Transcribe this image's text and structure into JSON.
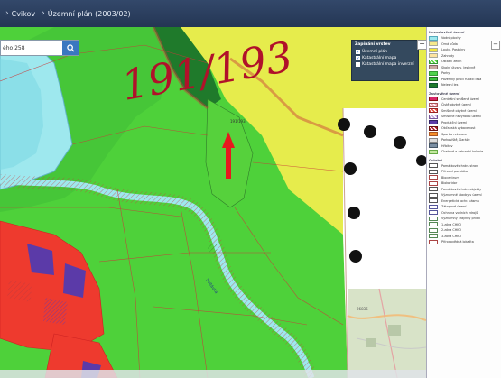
{
  "header": {
    "breadcrumb": [
      {
        "label": "Cvikov"
      },
      {
        "label": "Územní plán (2003/02)"
      }
    ]
  },
  "search": {
    "value": "ého 258"
  },
  "annotation": {
    "text": "191/193",
    "color": "#b0112a"
  },
  "layers_panel": {
    "title": "Zapínání vrstev",
    "items": [
      {
        "label": "Územní plán",
        "checked": true
      },
      {
        "label": "Katastrální mapa",
        "checked": true
      },
      {
        "label": "Katastrální mapa inverzní",
        "checked": false
      }
    ]
  },
  "map_labels": {
    "parcel_1": "191/193",
    "stream": "Svitávka"
  },
  "minimap": {
    "label": "26836"
  },
  "legend": {
    "sections": [
      {
        "title": "Nezastavěné území",
        "items": [
          {
            "label": "Vodní plochy",
            "color": "#9ee8ee",
            "stroke": "#5ab"
          },
          {
            "label": "Orná půda",
            "color": "#f5e98a",
            "stroke": "#aa9"
          },
          {
            "label": "Louky, Pastviny",
            "color": "#f2e63a",
            "stroke": "#aa9"
          },
          {
            "label": "Zahrady",
            "color": "#fde3a0",
            "stroke": "#aa9"
          },
          {
            "label": "Ostatní zeleň",
            "color": "#56d13c",
            "stroke": "#393",
            "hatch": true
          },
          {
            "label": "Skalní útvary, Jeskyně",
            "color": "#c9a9a0",
            "stroke": "#866"
          },
          {
            "label": "Parky",
            "color": "#4fd24c",
            "stroke": "#393"
          },
          {
            "label": "Pozemky plnící funkci lesa",
            "color": "#37c13a",
            "stroke": "#262"
          },
          {
            "label": "Nelesní les",
            "color": "#1e7a2a",
            "stroke": "#153"
          }
        ]
      },
      {
        "title": "Zastavěné území",
        "items": [
          {
            "label": "Centrální smíšené území",
            "color": "#d6266a",
            "stroke": "#811"
          },
          {
            "label": "Čistě obytné území",
            "color": "#f2a7b3",
            "stroke": "#a55",
            "hatch": true
          },
          {
            "label": "Smíšené obytné území",
            "color": "#e84a3a",
            "stroke": "#922",
            "hatch": true
          },
          {
            "label": "Smíšené nevýrobní území",
            "color": "#c2a6d8",
            "stroke": "#759",
            "hatch": true
          },
          {
            "label": "Produkční území",
            "color": "#5b3aa8",
            "stroke": "#326"
          },
          {
            "label": "Občanská vybavenost",
            "color": "#b2172a",
            "stroke": "#611",
            "hatch": true
          },
          {
            "label": "Sport a rekreace",
            "color": "#f58f2a",
            "stroke": "#a52"
          },
          {
            "label": "Parkoviště, Garáže",
            "color": "#dcdcdc",
            "stroke": "#888"
          },
          {
            "label": "Hřbitov",
            "color": "#7b8fa3",
            "stroke": "#456"
          },
          {
            "label": "Chatové a zahradní kolonie",
            "color": "#c3e8a0",
            "stroke": "#6a4"
          }
        ]
      },
      {
        "title": "Ostatní",
        "items": [
          {
            "label": "Památkové chrán. stran",
            "color": "#ffffff",
            "stroke": "#555"
          },
          {
            "label": "Přírodní památka",
            "color": "#ffffff",
            "stroke": "#555"
          },
          {
            "label": "Biocentrum",
            "color": "#ffffff",
            "stroke": "#a44"
          },
          {
            "label": "Biokoridor",
            "color": "#ffffff",
            "stroke": "#a44"
          },
          {
            "label": "Památkové chrán. objekty",
            "color": "#ffffff",
            "stroke": "#555"
          },
          {
            "label": "Významné stavby v území",
            "color": "#ffffff",
            "stroke": "#555"
          },
          {
            "label": "Energetické ochr. pásma",
            "color": "#ffffff",
            "stroke": "#555"
          },
          {
            "label": "Zátopové území",
            "color": "#ffffff",
            "stroke": "#559"
          },
          {
            "label": "Ochrana vodních zdrojů",
            "color": "#ffffff",
            "stroke": "#559"
          },
          {
            "label": "Významný krajinný prvek",
            "color": "#ffffff",
            "stroke": "#585"
          },
          {
            "label": "1.zóna CHKO",
            "color": "#ffffff",
            "stroke": "#585"
          },
          {
            "label": "2.zóna CHKO",
            "color": "#ffffff",
            "stroke": "#585"
          },
          {
            "label": "3.zóna CHKO",
            "color": "#ffffff",
            "stroke": "#585"
          },
          {
            "label": "Přírodovědná lokalita",
            "color": "#ffffff",
            "stroke": "#a44"
          }
        ]
      }
    ]
  }
}
